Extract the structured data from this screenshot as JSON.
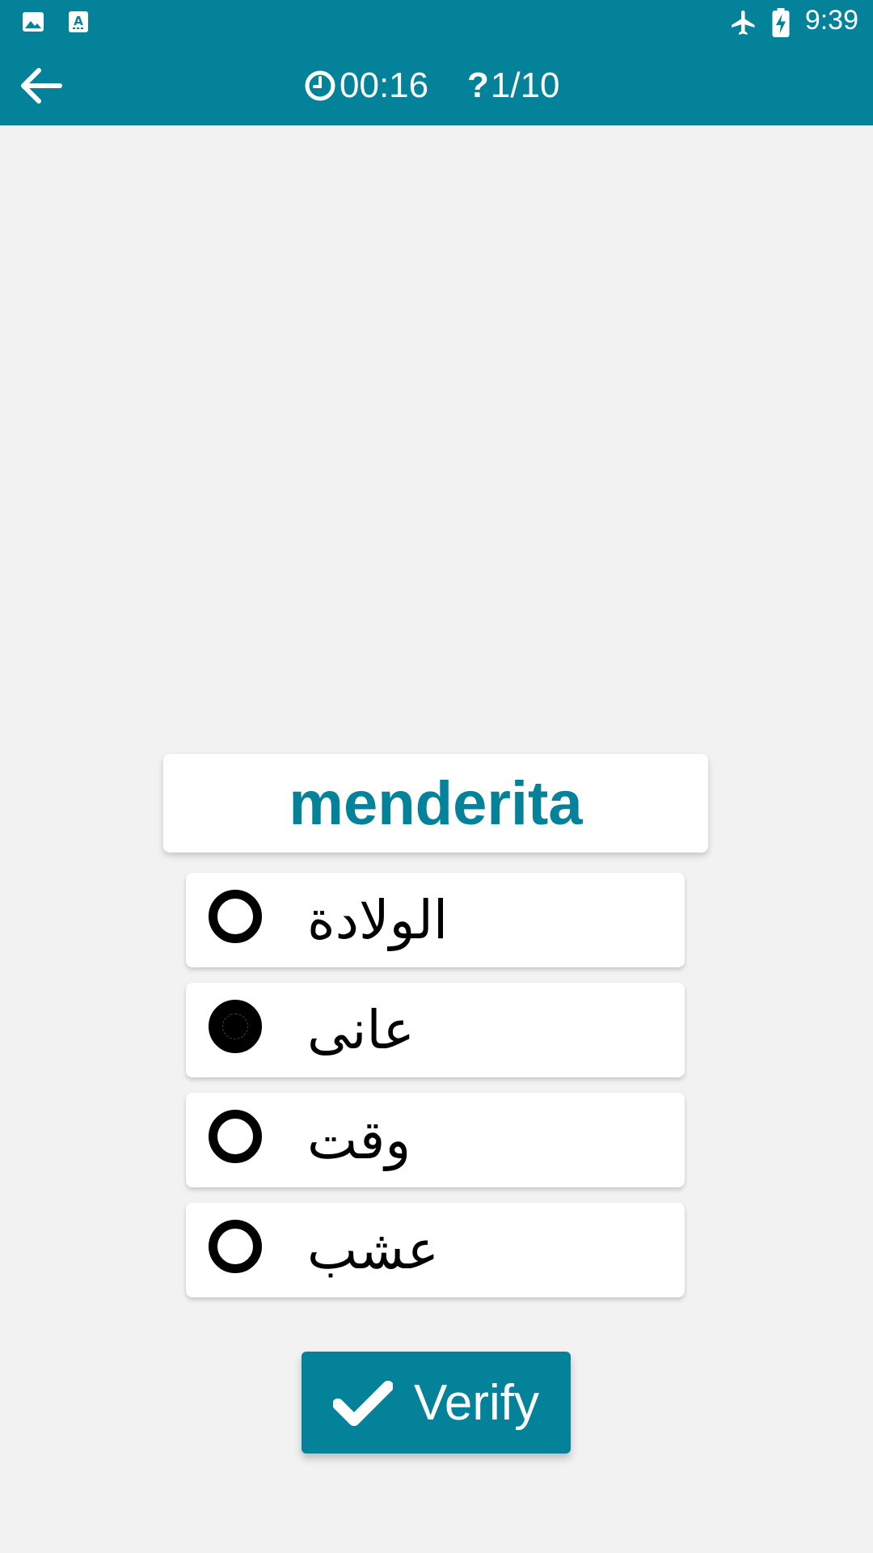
{
  "status_bar": {
    "time": "9:39",
    "icons": [
      "image-icon",
      "font-icon",
      "airplane-icon",
      "battery-charging-icon"
    ]
  },
  "app_bar": {
    "back_icon": "arrow-left-icon",
    "timer_icon": "clock-icon",
    "timer": "00:16",
    "progress_icon": "question-icon",
    "progress_mark": "?",
    "progress": "1/10"
  },
  "quiz": {
    "word": "menderita",
    "options": [
      {
        "label": "الولادة",
        "selected": false
      },
      {
        "label": "عانى",
        "selected": true
      },
      {
        "label": "وقت",
        "selected": false
      },
      {
        "label": "عشب",
        "selected": false
      }
    ]
  },
  "verify_button": {
    "icon": "check-icon",
    "label": "Verify"
  },
  "colors": {
    "primary": "#03829a",
    "background": "#f2f2f2",
    "card": "#ffffff",
    "text": "#000000"
  }
}
